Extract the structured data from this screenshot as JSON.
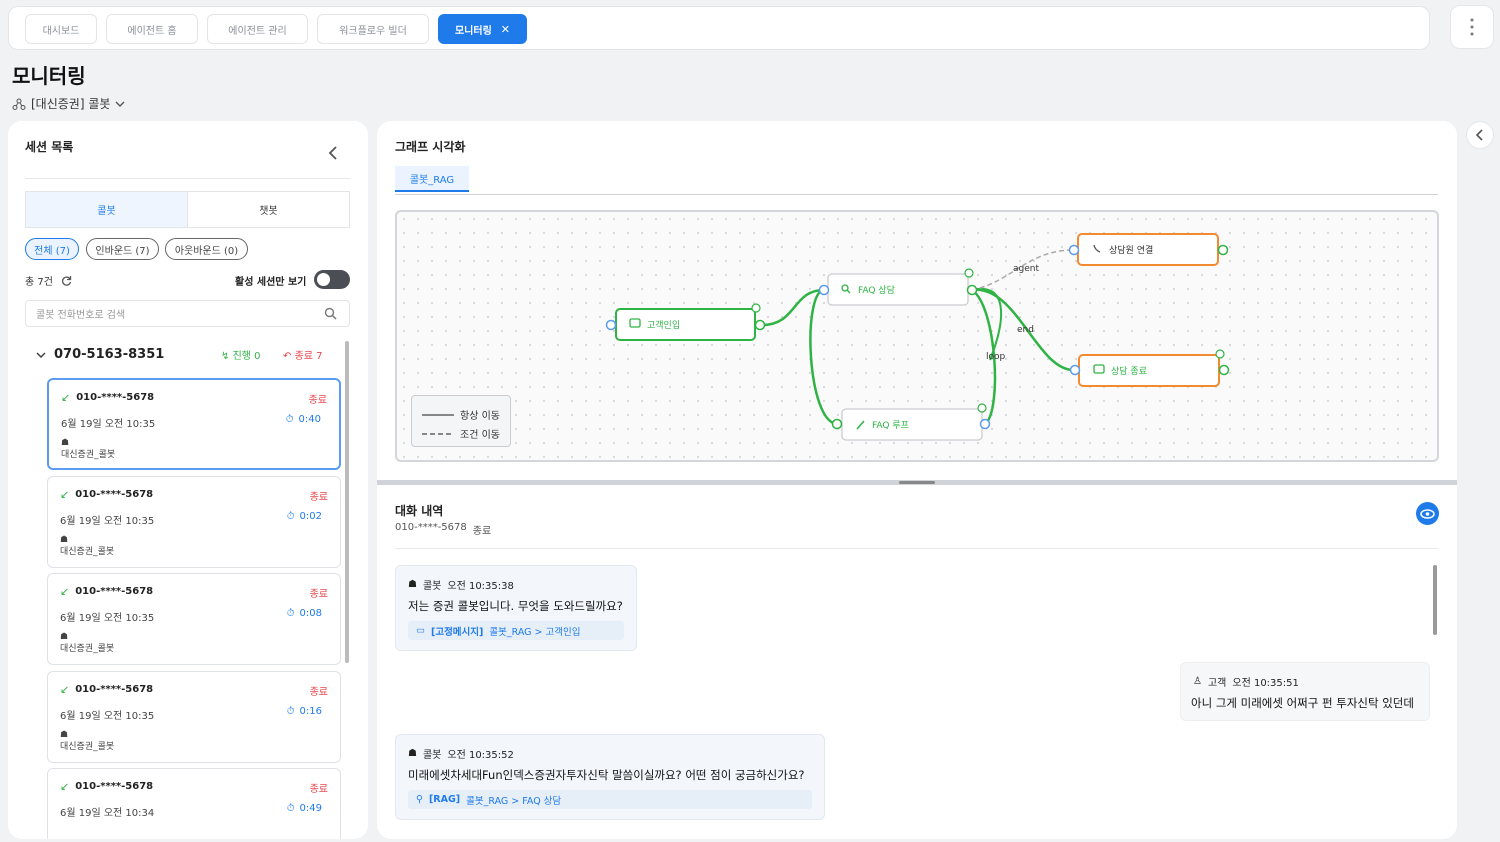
{
  "tabs": [
    {
      "label": "대시보드",
      "active": false
    },
    {
      "label": "에이전트 홈",
      "active": false
    },
    {
      "label": "에이전트 관리",
      "active": false
    },
    {
      "label": "워크플로우 빌더",
      "active": false
    },
    {
      "label": "모니터링",
      "active": true
    }
  ],
  "page": {
    "title": "모니터링",
    "bot_selector": "[대신증권] 콜봇"
  },
  "sessions": {
    "title": "세션 목록",
    "seg_tabs": [
      "콜봇",
      "챗봇"
    ],
    "filters": [
      "전체 (7)",
      "인바운드 (7)",
      "아웃바운드 (0)"
    ],
    "total": "총 7건",
    "active_only_label": "활성 세션만 보기",
    "search_placeholder": "콜봇 전화번호로 검색",
    "group": {
      "number": "070-5163-8351",
      "in_progress": "진행 0",
      "ended": "종료 7"
    },
    "cards": [
      {
        "phone": "010-****-5678",
        "status": "종료",
        "date": "6월 19일 오전 10:35",
        "duration": "0:40",
        "bot": "대신증권_콜봇"
      },
      {
        "phone": "010-****-5678",
        "status": "종료",
        "date": "6월 19일 오전 10:35",
        "duration": "0:02",
        "bot": "대신증권_콜봇"
      },
      {
        "phone": "010-****-5678",
        "status": "종료",
        "date": "6월 19일 오전 10:35",
        "duration": "0:08",
        "bot": "대신증권_콜봇"
      },
      {
        "phone": "010-****-5678",
        "status": "종료",
        "date": "6월 19일 오전 10:35",
        "duration": "0:16",
        "bot": "대신증권_콜봇"
      },
      {
        "phone": "010-****-5678",
        "status": "종료",
        "date": "6월 19일 오전 10:34",
        "duration": "0:49",
        "bot": ""
      }
    ]
  },
  "graph": {
    "title": "그래프 시각화",
    "tab": "콜봇_RAG",
    "nodes": {
      "intro": "고객인입",
      "faq": "FAQ 상담",
      "faq_loop": "FAQ 루프",
      "agent": "상담원 연결",
      "end": "상담 종료"
    },
    "edge_labels": {
      "agent": "agent",
      "end": "end",
      "loop": "loop"
    },
    "legend": {
      "always": "항상 이동",
      "conditional": "조건 이동"
    },
    "colors": {
      "active_edge": "#2fb344",
      "start_node": "#2fb344",
      "end_node": "#f28a30",
      "port": "#5b9cf0"
    }
  },
  "chat": {
    "title": "대화 내역",
    "sub_phone": "010-****-5678",
    "sub_status": "종료",
    "messages": [
      {
        "role": "bot",
        "sender": "콜봇",
        "time": "오전 10:35:38",
        "text": "저는 증권 콜봇입니다. 무엇을 도와드릴까요?",
        "ref_tag": "[고정메시지]",
        "ref_path": "콜봇_RAG > 고객인입"
      },
      {
        "role": "user",
        "sender": "고객",
        "time": "오전 10:35:51",
        "text": "아니 그게 미래에셋 어쩌구 펀 투자신탁 있던데"
      },
      {
        "role": "bot",
        "sender": "콜봇",
        "time": "오전 10:35:52",
        "text": "미래에셋차세대Fun인덱스증권자투자신탁 말씀이실까요? 어떤 점이 궁금하신가요?",
        "ref_tag": "[RAG]",
        "ref_path": "콜봇_RAG > FAQ 상담"
      }
    ]
  }
}
